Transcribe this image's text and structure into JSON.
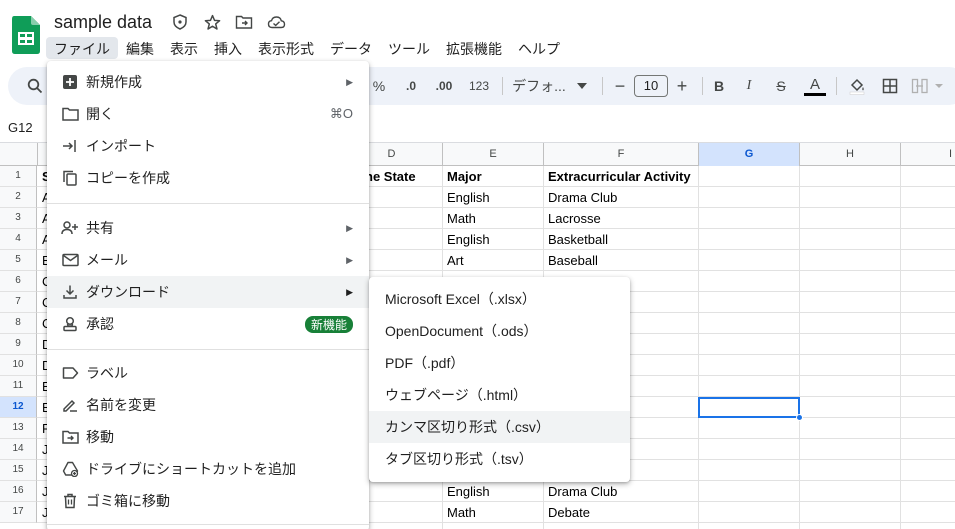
{
  "doc": {
    "title": "sample data"
  },
  "menubar": [
    {
      "label": "ファイル",
      "active": true
    },
    {
      "label": "編集"
    },
    {
      "label": "表示"
    },
    {
      "label": "挿入"
    },
    {
      "label": "表示形式"
    },
    {
      "label": "データ"
    },
    {
      "label": "ツール"
    },
    {
      "label": "拡張機能"
    },
    {
      "label": "ヘルプ"
    }
  ],
  "toolbar": {
    "percent": "%",
    "dec_decrease": ".0",
    "dec_increase": ".00",
    "number_format": "123",
    "font_name": "デフォ...",
    "font_size": "10",
    "minus": "−",
    "plus": "+",
    "bold": "B",
    "italic": "I",
    "strike": "S",
    "text_color": "A"
  },
  "name_box": "G12",
  "grid": {
    "columns": [
      {
        "label": "D",
        "selected": false
      },
      {
        "label": "E",
        "selected": false
      },
      {
        "label": "F",
        "selected": false
      },
      {
        "label": "G",
        "selected": true
      },
      {
        "label": "H",
        "selected": false
      },
      {
        "label": "I",
        "selected": false
      }
    ],
    "rows": [
      "1",
      "2",
      "3",
      "4",
      "5",
      "6",
      "7",
      "8",
      "9",
      "10",
      "11",
      "12",
      "13",
      "14",
      "15",
      "16",
      "17"
    ],
    "selected_row": "12",
    "col_a_fragments": [
      "S",
      "A",
      "A",
      "A",
      "E",
      "C",
      "C",
      "C",
      "D",
      "D",
      "E",
      "E",
      "F",
      "J",
      "J",
      "J",
      "J"
    ],
    "col_d_header_fragment": "ne State",
    "headers": {
      "major": "Major",
      "activity": "Extracurricular Activity"
    },
    "data": [
      {
        "major": "English",
        "activity": "Drama Club"
      },
      {
        "major": "Math",
        "activity": "Lacrosse"
      },
      {
        "major": "English",
        "activity": "Basketball"
      },
      {
        "major": "Art",
        "activity": "Baseball"
      }
    ],
    "bottom_data": [
      {
        "major": "English",
        "activity": "Drama Club"
      },
      {
        "major": "Math",
        "activity": "Debate"
      }
    ]
  },
  "file_menu": {
    "items": [
      {
        "label": "新規作成",
        "icon": "new-sheet-icon",
        "arrow": true
      },
      {
        "label": "開く",
        "icon": "folder-open-icon",
        "shortcut": "⌘O"
      },
      {
        "label": "インポート",
        "icon": "import-icon"
      },
      {
        "label": "コピーを作成",
        "icon": "copy-icon"
      },
      {
        "label": "共有",
        "icon": "person-add-icon",
        "arrow": true
      },
      {
        "label": "メール",
        "icon": "mail-icon",
        "arrow": true
      },
      {
        "label": "ダウンロード",
        "icon": "download-icon",
        "arrow": true,
        "hover": true
      },
      {
        "label": "承認",
        "icon": "approval-icon",
        "badge": "新機能"
      },
      {
        "label": "ラベル",
        "icon": "label-icon"
      },
      {
        "label": "名前を変更",
        "icon": "rename-icon"
      },
      {
        "label": "移動",
        "icon": "move-folder-icon"
      },
      {
        "label": "ドライブにショートカットを追加",
        "icon": "drive-shortcut-icon"
      },
      {
        "label": "ゴミ箱に移動",
        "icon": "trash-icon"
      }
    ]
  },
  "download_menu": {
    "items": [
      {
        "label": "Microsoft Excel（.xlsx）"
      },
      {
        "label": "OpenDocument（.ods）"
      },
      {
        "label": "PDF（.pdf）"
      },
      {
        "label": "ウェブページ（.html）"
      },
      {
        "label": "カンマ区切り形式（.csv）",
        "hover": true
      },
      {
        "label": "タブ区切り形式（.tsv）"
      }
    ]
  },
  "colors": {
    "accent": "#1a73e8",
    "badge": "#188038",
    "logo": "#0f9d58",
    "toolbar_bg": "#eef2f9"
  }
}
